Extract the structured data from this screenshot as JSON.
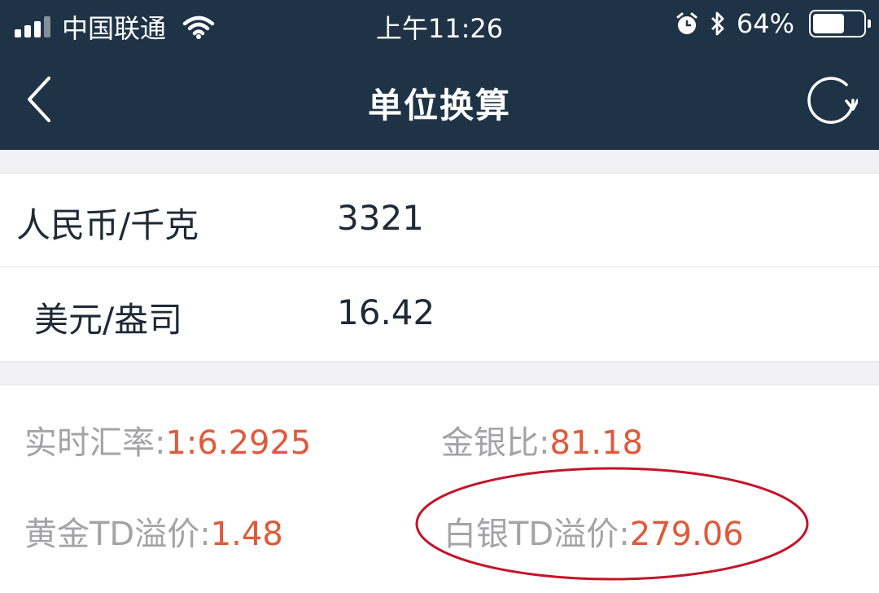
{
  "status_bar": {
    "carrier": "中国联通",
    "time": "上午11:26",
    "battery_text": "64%",
    "battery_level": 0.64,
    "icons": [
      "signal-icon",
      "wifi-icon",
      "alarm-icon",
      "bluetooth-icon",
      "battery-icon"
    ]
  },
  "nav": {
    "title": "单位换算",
    "back_icon": "chevron-left-icon",
    "refresh_icon": "refresh-icon"
  },
  "converter": {
    "rows": [
      {
        "unit": "人民币/千克",
        "value": "3321"
      },
      {
        "unit": "美元/盎司",
        "value": "16.42"
      }
    ]
  },
  "stats": [
    {
      "label": "实时汇率:",
      "value": "1:6.2925"
    },
    {
      "label": "金银比:",
      "value": "81.18"
    },
    {
      "label": "黄金TD溢价:",
      "value": "1.48"
    },
    {
      "label": "白银TD溢价:",
      "value": "279.06"
    }
  ],
  "colors": {
    "header_bg": "#1f3347",
    "page_bg": "#f2f2f4",
    "label_gray": "#a3a3a8",
    "value_accent": "#e0593a",
    "annotation_red": "#c4142a"
  }
}
